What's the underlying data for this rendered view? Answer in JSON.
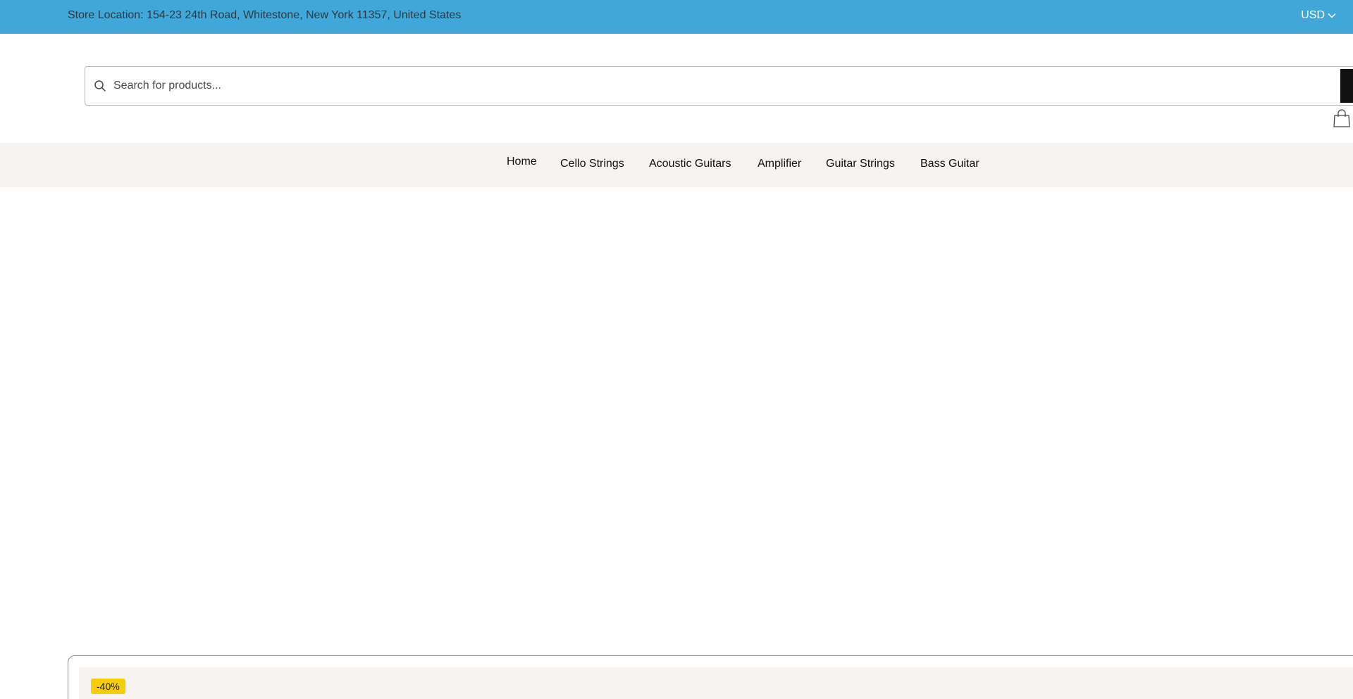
{
  "topbar": {
    "store_location": "Store Location: 154-23 24th Road, Whitestone, New York 11357, United States",
    "currency": "USD",
    "background_color": "#41a6d8"
  },
  "header": {
    "search": {
      "placeholder": "Search for products...",
      "value": ""
    },
    "icons": [
      "search-icon",
      "cart-icon",
      "chevron-down-icon"
    ]
  },
  "nav": {
    "items": [
      {
        "label": "Home"
      },
      {
        "label": "Cello Strings"
      },
      {
        "label": "Acoustic Guitars"
      },
      {
        "label": "Amplifier"
      },
      {
        "label": "Guitar Strings"
      },
      {
        "label": "Bass Guitar"
      }
    ],
    "background_color": "#f7f3f1"
  },
  "product": {
    "discount_badge": "-40%",
    "badge_color": "#f6cd09"
  }
}
